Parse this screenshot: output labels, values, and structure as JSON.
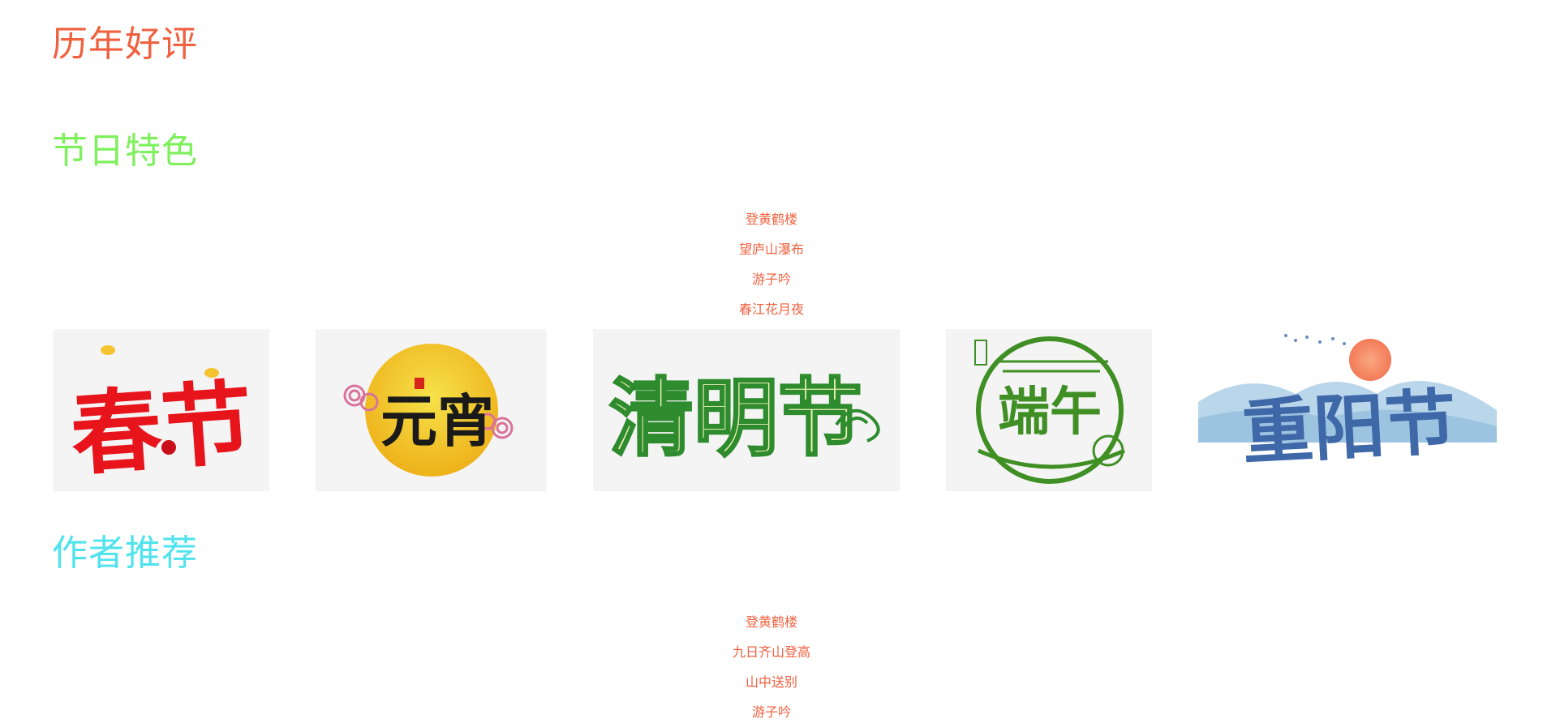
{
  "sections": {
    "reviews": {
      "title": "历年好评"
    },
    "festivals": {
      "title": "节日特色",
      "poems": [
        "登黄鹤楼",
        "望庐山瀑布",
        "游子吟",
        "春江花月夜"
      ],
      "images": [
        {
          "label": "春节",
          "color": "#e8141c"
        },
        {
          "label": "元宵",
          "color": "#f0c81e"
        },
        {
          "label": "清明节",
          "color": "#2e8b2e"
        },
        {
          "label": "端午",
          "color": "#3f8f24"
        },
        {
          "label": "重阳节",
          "color": "#3f68a8"
        }
      ]
    },
    "authors": {
      "title": "作者推荐",
      "poems": [
        "登黄鹤楼",
        "九日齐山登高",
        "山中送别",
        "游子吟"
      ]
    }
  }
}
